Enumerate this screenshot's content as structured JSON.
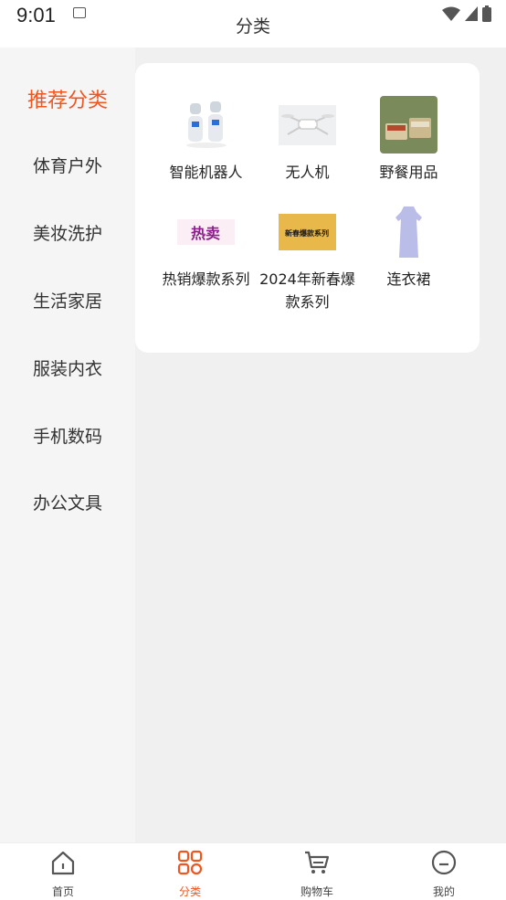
{
  "status": {
    "time": "9:01"
  },
  "header": {
    "title": "分类"
  },
  "sidebar": {
    "items": [
      {
        "label": "推荐分类",
        "active": true
      },
      {
        "label": "体育户外"
      },
      {
        "label": "美妆洗护"
      },
      {
        "label": "生活家居"
      },
      {
        "label": "服装内衣"
      },
      {
        "label": "手机数码"
      },
      {
        "label": "办公文具"
      }
    ]
  },
  "grid": {
    "items": [
      {
        "label": "智能机器人",
        "icon": "robot-image"
      },
      {
        "label": "无人机",
        "icon": "drone-image"
      },
      {
        "label": "野餐用品",
        "icon": "picnic-image"
      },
      {
        "label": "热销爆款系列",
        "icon": "hot-sale-image",
        "badge": "热卖"
      },
      {
        "label": "2024年新春爆款系列",
        "icon": "new-spring-image",
        "badge": "新春爆款系列"
      },
      {
        "label": "连衣裙",
        "icon": "dress-image"
      }
    ]
  },
  "tabbar": {
    "items": [
      {
        "label": "首页",
        "icon": "home-icon"
      },
      {
        "label": "分类",
        "icon": "category-icon",
        "active": true
      },
      {
        "label": "购物车",
        "icon": "cart-icon"
      },
      {
        "label": "我的",
        "icon": "profile-icon"
      }
    ]
  },
  "colors": {
    "accent": "#f0561e",
    "background": "#f5f5f5",
    "card": "#ffffff"
  }
}
